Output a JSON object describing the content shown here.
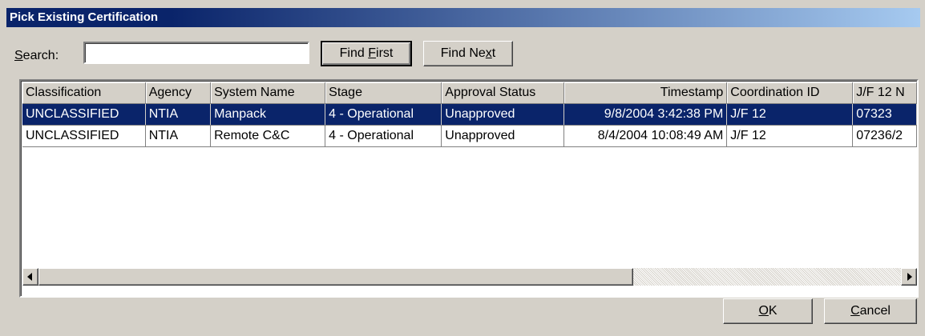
{
  "window": {
    "title": "Pick Existing Certification"
  },
  "search": {
    "label_accel": "S",
    "label_rest": "earch:",
    "value": ""
  },
  "buttons": {
    "find_first": {
      "pre": "Find ",
      "accel": "F",
      "post": "irst"
    },
    "find_next": {
      "pre": "Find Ne",
      "accel": "x",
      "post": "t"
    },
    "ok": {
      "pre": "",
      "accel": "O",
      "post": "K"
    },
    "cancel": {
      "pre": "",
      "accel": "C",
      "post": "ancel"
    }
  },
  "grid": {
    "columns": [
      "Classification",
      "Agency",
      "System Name",
      "Stage",
      "Approval Status",
      "Timestamp",
      "Coordination ID",
      "J/F 12 N"
    ],
    "rows": [
      [
        "UNCLASSIFIED",
        "NTIA",
        "Manpack",
        "4 - Operational",
        "Unapproved",
        "9/8/2004 3:42:38 PM",
        "J/F 12",
        "07323"
      ],
      [
        "UNCLASSIFIED",
        "NTIA",
        "Remote C&C",
        "4 - Operational",
        "Unapproved",
        "8/4/2004 10:08:49 AM",
        "J/F 12",
        "07236/2"
      ]
    ],
    "selected_row": 0
  },
  "icons": {
    "scroll_left": "left-arrow-icon",
    "scroll_right": "right-arrow-icon"
  },
  "colors": {
    "title_start": "#0a246a",
    "title_end": "#a6caf0",
    "selection": "#0a246a",
    "face": "#d4d0c8"
  }
}
